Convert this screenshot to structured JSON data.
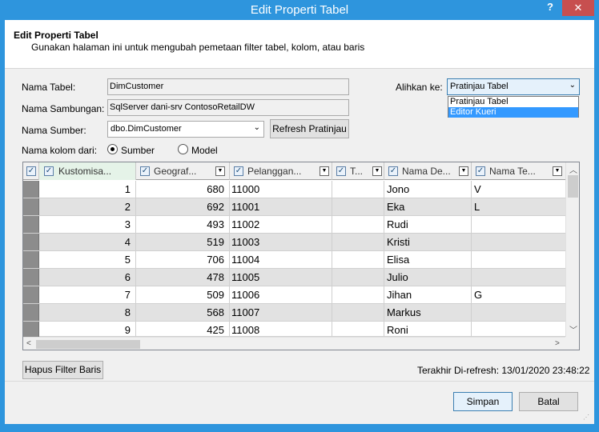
{
  "window": {
    "title": "Edit Properti Tabel",
    "help_label": "?",
    "close_label": "✕"
  },
  "header": {
    "title": "Edit Properti Tabel",
    "subtitle": "Gunakan halaman ini untuk mengubah pemetaan filter tabel, kolom, atau baris"
  },
  "form": {
    "table_name_label": "Nama Tabel:",
    "table_name_value": "DimCustomer",
    "connection_label": "Nama Sambungan:",
    "connection_value": "SqlServer dani-srv ContosoRetailDW",
    "source_label": "Nama Sumber:",
    "source_value": "dbo.DimCustomer",
    "refresh_preview_label": "Refresh Pratinjau",
    "column_names_label": "Nama kolom dari:",
    "radio_source_label": "Sumber",
    "radio_model_label": "Model",
    "switch_label": "Alihkan ke:",
    "switch_value": "Pratinjau Tabel",
    "switch_options": [
      "Pratinjau Tabel",
      "Editor Kueri"
    ]
  },
  "grid": {
    "columns": [
      "Kustomisa...",
      "Geograf...",
      "Pelanggan...",
      "T...",
      "Nama De...",
      "Nama Te..."
    ],
    "rows": [
      [
        "1",
        "680",
        "11000",
        "",
        "Jono",
        "V"
      ],
      [
        "2",
        "692",
        "11001",
        "",
        "Eka",
        "L"
      ],
      [
        "3",
        "493",
        "11002",
        "",
        "Rudi",
        ""
      ],
      [
        "4",
        "519",
        "11003",
        "",
        "Kristi",
        ""
      ],
      [
        "5",
        "706",
        "11004",
        "",
        "Elisa",
        ""
      ],
      [
        "6",
        "478",
        "11005",
        "",
        "Julio",
        ""
      ],
      [
        "7",
        "509",
        "11006",
        "",
        "Jihan",
        "G"
      ],
      [
        "8",
        "568",
        "11007",
        "",
        "Markus",
        ""
      ],
      [
        "9",
        "425",
        "11008",
        "",
        "Roni",
        ""
      ]
    ]
  },
  "footer": {
    "clear_filter_label": "Hapus Filter Baris",
    "last_refresh_label": "Terakhir Di-refresh: 13/01/2020 23:48:22",
    "save_label": "Simpan",
    "cancel_label": "Batal"
  },
  "colors": {
    "title_bar": "#2e95dd",
    "close_button": "#c74f4f",
    "selected_item": "#3399ff"
  }
}
